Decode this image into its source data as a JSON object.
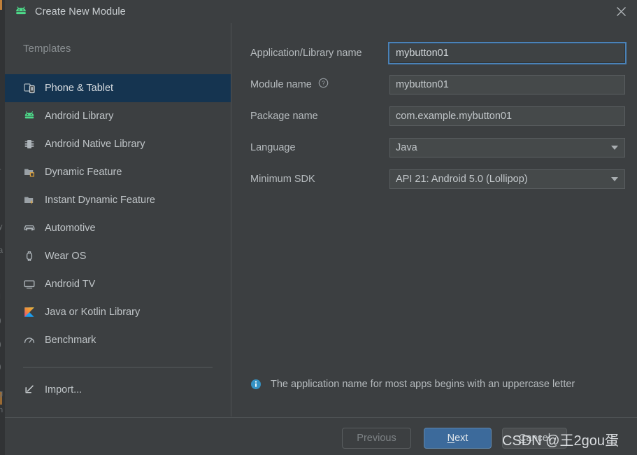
{
  "window": {
    "title": "Create New Module",
    "app_icon": "android-robot-icon",
    "close_icon": "close-icon"
  },
  "sidebar": {
    "header": "Templates",
    "items": [
      {
        "label": "Phone & Tablet",
        "icon": "phone-tablet-icon",
        "selected": true
      },
      {
        "label": "Android Library",
        "icon": "android-robot-icon",
        "selected": false
      },
      {
        "label": "Android Native Library",
        "icon": "native-library-chip-icon",
        "selected": false
      },
      {
        "label": "Dynamic Feature",
        "icon": "dynamic-feature-folder-icon",
        "selected": false
      },
      {
        "label": "Instant Dynamic Feature",
        "icon": "instant-feature-folder-icon",
        "selected": false
      },
      {
        "label": "Automotive",
        "icon": "car-icon",
        "selected": false
      },
      {
        "label": "Wear OS",
        "icon": "watch-icon",
        "selected": false
      },
      {
        "label": "Android TV",
        "icon": "tv-icon",
        "selected": false
      },
      {
        "label": "Java or Kotlin Library",
        "icon": "kotlin-logo-icon",
        "selected": false
      },
      {
        "label": "Benchmark",
        "icon": "benchmark-gauge-icon",
        "selected": false
      }
    ],
    "import_label": "Import...",
    "import_icon": "import-arrow-icon"
  },
  "form": {
    "fields": [
      {
        "label": "Application/Library name",
        "type": "text",
        "value": "mybutton01",
        "focused": true,
        "help": false
      },
      {
        "label": "Module name",
        "type": "text",
        "value": "mybutton01",
        "focused": false,
        "help": true,
        "help_icon": "question-mark-circle-icon"
      },
      {
        "label": "Package name",
        "type": "text",
        "value": "com.example.mybutton01",
        "focused": false,
        "help": false
      },
      {
        "label": "Language",
        "type": "select",
        "value": "Java",
        "focused": false,
        "help": false
      },
      {
        "label": "Minimum SDK",
        "type": "select",
        "value": "API 21: Android 5.0 (Lollipop)",
        "focused": false,
        "help": false
      }
    ],
    "hint": {
      "icon": "info-circle-icon",
      "message": "The application name for most apps begins with an uppercase letter"
    }
  },
  "footer": {
    "previous_label": "Previous",
    "next_label": "Next",
    "next_mnemonic": "N",
    "cancel_label": "Cancel",
    "cancel_mnemonic": "C"
  },
  "watermark": "CSDN @王2gou蛋",
  "colors": {
    "dialog_background": "#3c3f41",
    "selection_blue": "#153450",
    "focus_border_blue": "#4a82b8",
    "primary_button_blue": "#3c6a9b",
    "android_green": "#4ddb8a",
    "info_blue": "#3592c4",
    "text_primary": "#c0c5c8",
    "text_muted": "#8a8f92"
  },
  "background_ghost_text": [
    "-",
    "y",
    "a",
    "l",
    "I",
    ")",
    ")",
    ")",
    "g",
    "n"
  ]
}
